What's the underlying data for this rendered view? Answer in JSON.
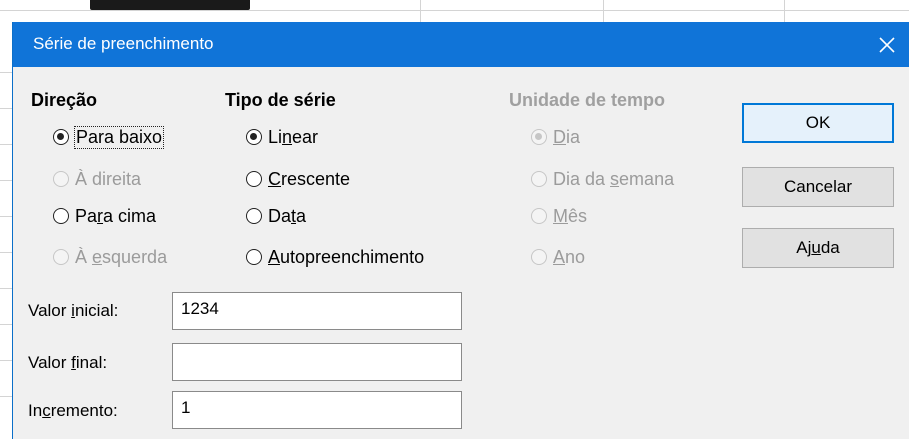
{
  "dialog": {
    "title": "Série de preenchimento",
    "close_icon": "close-icon"
  },
  "direction": {
    "heading": "Direção",
    "options": [
      {
        "pre": "",
        "key": "",
        "post": "Para baixo",
        "checked": true,
        "disabled": false
      },
      {
        "pre": "À direita",
        "key": "",
        "post": "",
        "checked": false,
        "disabled": true
      },
      {
        "pre": "Pa",
        "key": "r",
        "post": "a cima",
        "checked": false,
        "disabled": false
      },
      {
        "pre": "À ",
        "key": "e",
        "post": "squerda",
        "checked": false,
        "disabled": true
      }
    ]
  },
  "series_type": {
    "heading": "Tipo de série",
    "options": [
      {
        "pre": "Li",
        "key": "n",
        "post": "ear",
        "checked": true,
        "disabled": false
      },
      {
        "pre": "",
        "key": "C",
        "post": "rescente",
        "checked": false,
        "disabled": false
      },
      {
        "pre": "Da",
        "key": "t",
        "post": "a",
        "checked": false,
        "disabled": false
      },
      {
        "pre": "",
        "key": "A",
        "post": "utopreenchimento",
        "checked": false,
        "disabled": false
      }
    ]
  },
  "time_unit": {
    "heading": "Unidade de tempo",
    "options": [
      {
        "pre": "",
        "key": "D",
        "post": "ia",
        "checked": true,
        "disabled": true
      },
      {
        "pre": "Dia da ",
        "key": "s",
        "post": "emana",
        "checked": false,
        "disabled": true
      },
      {
        "pre": "",
        "key": "M",
        "post": "ês",
        "checked": false,
        "disabled": true
      },
      {
        "pre": "",
        "key": "A",
        "post": "no",
        "checked": false,
        "disabled": true
      }
    ]
  },
  "buttons": {
    "ok": "OK",
    "cancel": "Cancelar",
    "help_pre": "Aj",
    "help_key": "u",
    "help_post": "da"
  },
  "fields": {
    "start_label_pre": "Valor ",
    "start_label_key": "i",
    "start_label_post": "nicial:",
    "start_value": "1234",
    "end_label_pre": "Valor ",
    "end_label_key": "f",
    "end_label_post": "inal:",
    "end_value": "",
    "increment_label_pre": "In",
    "increment_label_key": "c",
    "increment_label_post": "remento:",
    "increment_value": "1"
  },
  "colors": {
    "titlebar": "#1074d8",
    "default_button_border": "#0078d7"
  }
}
